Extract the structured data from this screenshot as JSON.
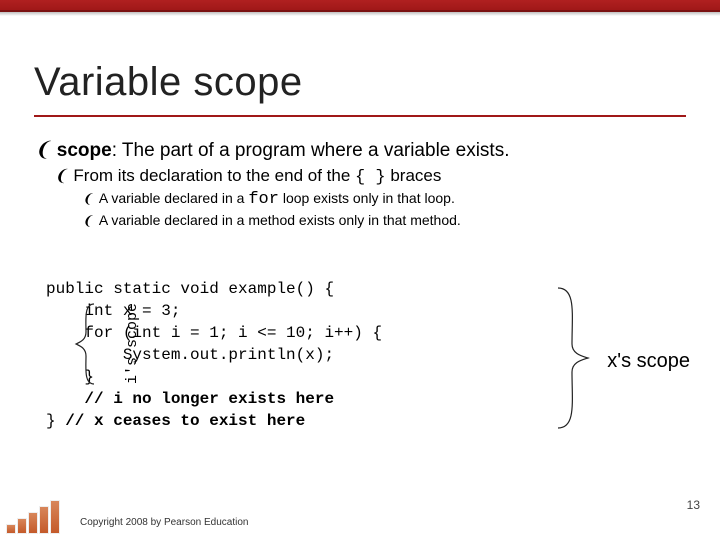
{
  "title": "Variable scope",
  "bullet_glyph": "❨",
  "b1": {
    "term": "scope",
    "colon": ": ",
    "rest": "The part of a program where a variable exists."
  },
  "b2": {
    "pre": "From its declaration to the end of the ",
    "braces": "{ }",
    "post": " braces"
  },
  "b3": {
    "pre": "A variable declared in a ",
    "kw": "for",
    "post": " loop exists only in that loop."
  },
  "b4": "A variable declared in a method exists only in that method.",
  "code": {
    "l1": "public static void example() {",
    "l2a": "    int x = 3;",
    "l3a": "    for (int i = 1; i <= 10; i++) {",
    "l4a": "        System.out.println(x);",
    "l5a": "    }",
    "l6a": "    ",
    "l6b": "// i no longer exists here",
    "l7a": "} ",
    "l7b": "// x ceases to exist here"
  },
  "i_scope": "i's scope",
  "x_scope": "x's scope",
  "copyright": "Copyright 2008 by Pearson Education",
  "page": "13"
}
